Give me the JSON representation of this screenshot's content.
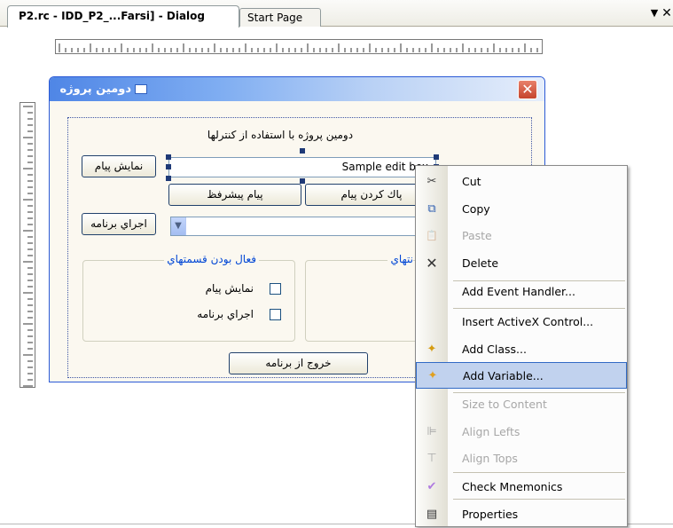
{
  "tabs": {
    "active_label": "P2.rc - IDD_P2_...Farsi] - Dialog",
    "start_page_label": "Start Page",
    "dropdown_glyph": "▼",
    "close_glyph": "✕"
  },
  "dialog": {
    "title": "دومین پروژه",
    "close_glyph": "✕",
    "heading": "دومین پروژه با استفاده از کنترلها",
    "show_message_button": "نمایش پیام",
    "edit_box_value": "Sample edit box",
    "advanced_message_button": "پیام پیشرفظ",
    "clear_message_button": "پاك كردن پیام",
    "run_app_button": "اجراي برنامه",
    "combo_arrow_glyph": "▼",
    "group_enable_caption": "فعال بودن قسمتهاي",
    "group_other_caption": "نتهاي",
    "checkbox_show_message": "نمایش پیام",
    "checkbox_run_app": "اجراي برنامه",
    "exit_button": "خروج از برنامه"
  },
  "context_menu": {
    "items": [
      {
        "label": "Cut",
        "icon": "scissors-icon",
        "glyph": "✂",
        "enabled": true
      },
      {
        "label": "Copy",
        "icon": "copy-icon",
        "glyph": "⧉",
        "enabled": true
      },
      {
        "label": "Paste",
        "icon": "paste-icon",
        "glyph": "📋",
        "enabled": false
      },
      {
        "label": "Delete",
        "icon": "delete-x-icon",
        "glyph": "✕",
        "enabled": true
      },
      {
        "label": "Add Event Handler...",
        "icon": "",
        "glyph": "",
        "enabled": true
      },
      {
        "label": "Insert ActiveX Control...",
        "icon": "",
        "glyph": "",
        "enabled": true
      },
      {
        "label": "Add Class...",
        "icon": "add-class-wand-icon",
        "glyph": "✦",
        "enabled": true
      },
      {
        "label": "Add Variable...",
        "icon": "add-variable-wand-icon",
        "glyph": "✦",
        "enabled": true,
        "highlighted": true
      },
      {
        "label": "Size to Content",
        "icon": "",
        "glyph": "",
        "enabled": false
      },
      {
        "label": "Align Lefts",
        "icon": "align-lefts-icon",
        "glyph": "⊫",
        "enabled": false
      },
      {
        "label": "Align Tops",
        "icon": "align-tops-icon",
        "glyph": "⊤",
        "enabled": false
      },
      {
        "label": "Check Mnemonics",
        "icon": "check-mnemonics-icon",
        "glyph": "✔",
        "enabled": true
      },
      {
        "label": "Properties",
        "icon": "properties-icon",
        "glyph": "▤",
        "enabled": true
      }
    ]
  },
  "colors": {
    "dialog_title_gradient_start": "#4f86e6",
    "menu_highlight": "#c1d2ee",
    "group_caption": "#0046d5",
    "disabled_text": "#a7a7a7"
  }
}
